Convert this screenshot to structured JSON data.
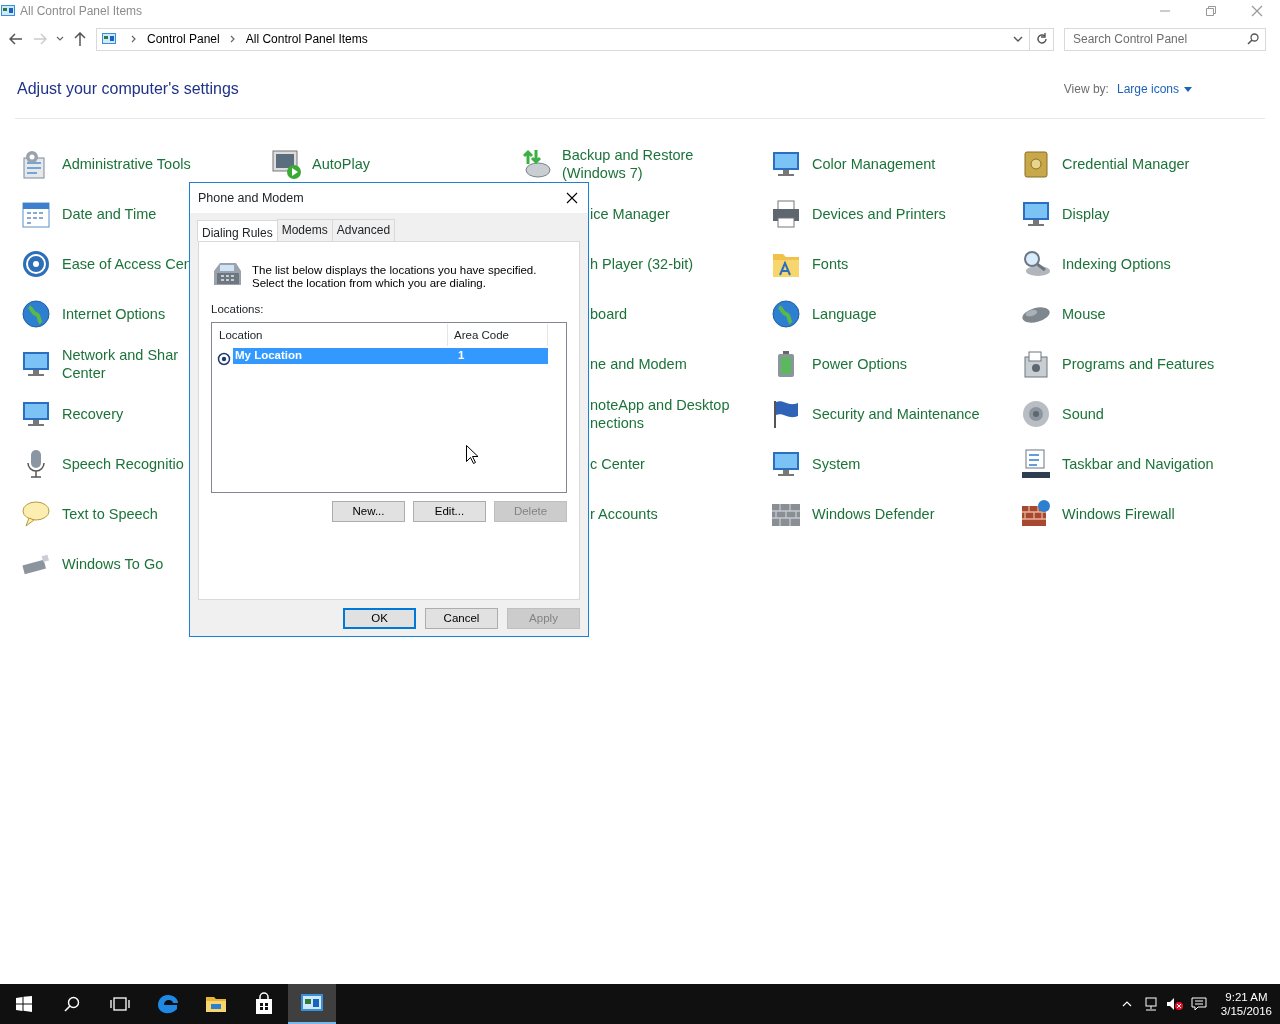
{
  "window": {
    "title": "All Control Panel Items"
  },
  "address_bar": {
    "breadcrumbs": [
      "Control Panel",
      "All Control Panel Items"
    ]
  },
  "search": {
    "placeholder": "Search Control Panel"
  },
  "heading": "Adjust your computer's settings",
  "view_by": {
    "label": "View by:",
    "value": "Large icons"
  },
  "columns": [
    {
      "items": [
        {
          "label": "Administrative Tools",
          "kind": "full"
        },
        {
          "label": "Date and Time",
          "kind": "full"
        },
        {
          "label": "Ease of Access Cen",
          "kind": "full"
        },
        {
          "label": "Internet Options",
          "kind": "full"
        },
        {
          "label": "Network and Shar\nCenter",
          "kind": "full"
        },
        {
          "label": "Recovery",
          "kind": "full"
        },
        {
          "label": "Speech Recognitio",
          "kind": "full"
        },
        {
          "label": "Text to Speech",
          "kind": "full"
        },
        {
          "label": "Windows To Go",
          "kind": "full"
        }
      ]
    },
    {
      "items": [
        {
          "label": "AutoPlay",
          "kind": "full"
        }
      ]
    },
    {
      "items": [
        {
          "label": "Backup and Restore\n(Windows 7)",
          "kind": "full"
        },
        {
          "label": "ice Manager",
          "kind": "behind_dialog"
        },
        {
          "label": "h Player (32-bit)",
          "kind": "behind_dialog"
        },
        {
          "label": "board",
          "kind": "behind_dialog"
        },
        {
          "label": "ne and Modem",
          "kind": "behind_dialog"
        },
        {
          "label": "noteApp and Desktop\nnections",
          "kind": "behind_dialog"
        },
        {
          "label": "c Center",
          "kind": "behind_dialog"
        },
        {
          "label": "r Accounts",
          "kind": "behind_dialog"
        }
      ]
    },
    {
      "items": [
        {
          "label": "Color Management",
          "kind": "full"
        },
        {
          "label": "Devices and Printers",
          "kind": "full"
        },
        {
          "label": "Fonts",
          "kind": "full"
        },
        {
          "label": "Language",
          "kind": "full"
        },
        {
          "label": "Power Options",
          "kind": "full"
        },
        {
          "label": "Security and Maintenance",
          "kind": "full"
        },
        {
          "label": "System",
          "kind": "full"
        },
        {
          "label": "Windows Defender",
          "kind": "full"
        }
      ]
    },
    {
      "items": [
        {
          "label": "Credential Manager",
          "kind": "full"
        },
        {
          "label": "Display",
          "kind": "full"
        },
        {
          "label": "Indexing Options",
          "kind": "full"
        },
        {
          "label": "Mouse",
          "kind": "full"
        },
        {
          "label": "Programs and Features",
          "kind": "full"
        },
        {
          "label": "Sound",
          "kind": "full"
        },
        {
          "label": "Taskbar and Navigation",
          "kind": "full"
        },
        {
          "label": "Windows Firewall",
          "kind": "full"
        }
      ]
    }
  ],
  "dialog": {
    "title": "Phone and Modem",
    "tabs": [
      {
        "label": "Dialing Rules",
        "selected": true
      },
      {
        "label": "Modems",
        "selected": false
      },
      {
        "label": "Advanced",
        "selected": false
      }
    ],
    "description": "The list below displays the locations you have specified. Select the location from which you are dialing.",
    "list_label": "Locations:",
    "list_columns": [
      "Location",
      "Area Code"
    ],
    "rows": [
      {
        "location": "My Location",
        "area_code": "1",
        "selected": true,
        "current": true
      }
    ],
    "list_buttons": [
      {
        "label": "New...",
        "disabled": false
      },
      {
        "label": "Edit...",
        "disabled": false
      },
      {
        "label": "Delete",
        "disabled": true
      }
    ],
    "buttons": [
      {
        "label": "OK",
        "default": true,
        "disabled": false
      },
      {
        "label": "Cancel",
        "default": false,
        "disabled": false
      },
      {
        "label": "Apply",
        "default": false,
        "disabled": true
      }
    ]
  },
  "taskbar": {
    "apps": [
      {
        "selected": false
      },
      {
        "selected": false
      },
      {
        "selected": false
      },
      {
        "selected": true
      }
    ],
    "time": "9:21 AM",
    "date": "3/15/2016"
  }
}
